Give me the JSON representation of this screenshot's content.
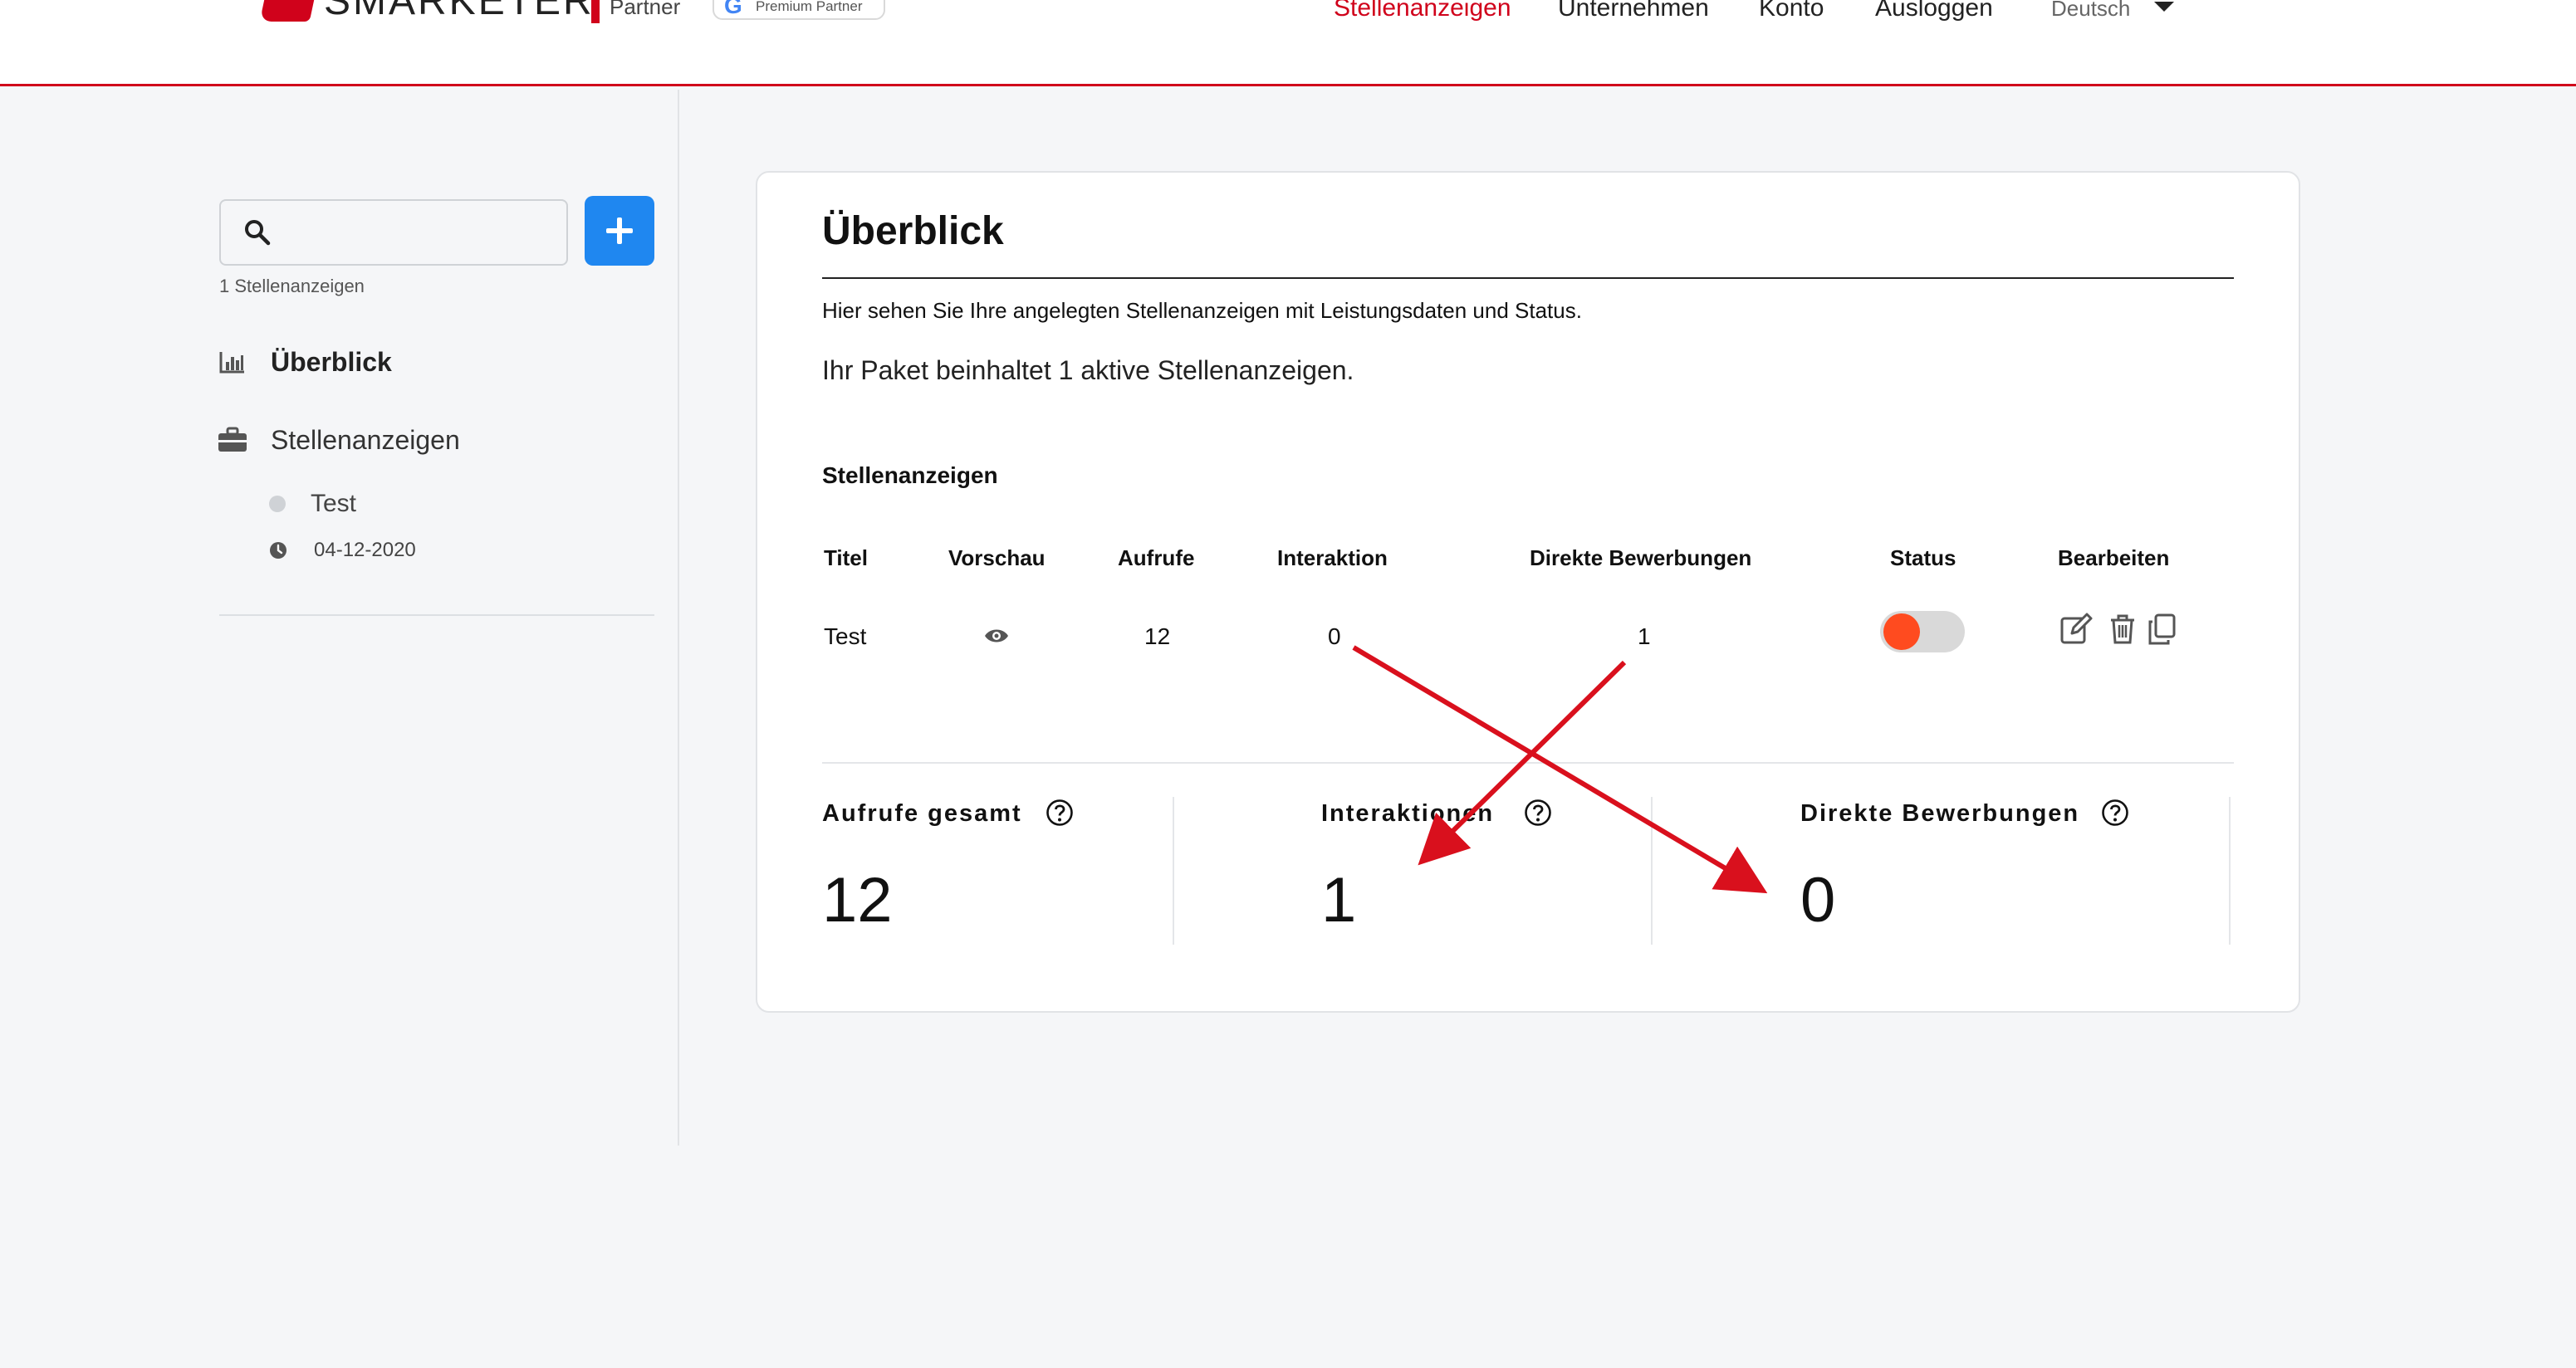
{
  "header": {
    "logo_text": "SMARKETER",
    "partner_label": "Partner",
    "google_badge": "Premium Partner",
    "google_letter": "G",
    "nav": [
      "Stellenanzeigen",
      "Unternehmen",
      "Konto",
      "Ausloggen"
    ],
    "language": "Deutsch",
    "accent_color": "#d0021b"
  },
  "sidebar": {
    "search_placeholder": "",
    "ads_count": "1 Stellenanzeigen",
    "items": [
      {
        "label": "Überblick",
        "icon": "bar-chart-icon",
        "active": true
      },
      {
        "label": "Stellenanzeigen",
        "icon": "briefcase-icon",
        "active": false
      }
    ],
    "sub_items": [
      {
        "label": "Test",
        "date": "04-12-2020"
      }
    ],
    "add_button_color": "#1f87f0"
  },
  "main": {
    "title": "Überblick",
    "description": "Hier sehen Sie Ihre angelegten Stellenanzeigen mit Leistungsdaten und Status.",
    "package_text": "Ihr Paket beinhaltet 1 aktive Stellenanzeigen.",
    "section_title": "Stellenanzeigen",
    "table": {
      "headers": [
        "Titel",
        "Vorschau",
        "Aufrufe",
        "Interaktion",
        "Direkte Bewerbungen",
        "Status",
        "Bearbeiten"
      ],
      "rows": [
        {
          "title": "Test",
          "preview": "eye-icon",
          "views": "12",
          "interactions": "0",
          "applications": "1",
          "status_on": true,
          "actions": [
            "edit-icon",
            "trash-icon",
            "copy-icon"
          ]
        }
      ]
    },
    "stats": [
      {
        "label": "Aufrufe gesamt",
        "value": "12"
      },
      {
        "label": "Interaktionen",
        "value": "1"
      },
      {
        "label": "Direkte Bewerbungen",
        "value": "0"
      }
    ],
    "annotation_color": "#d9101d"
  }
}
